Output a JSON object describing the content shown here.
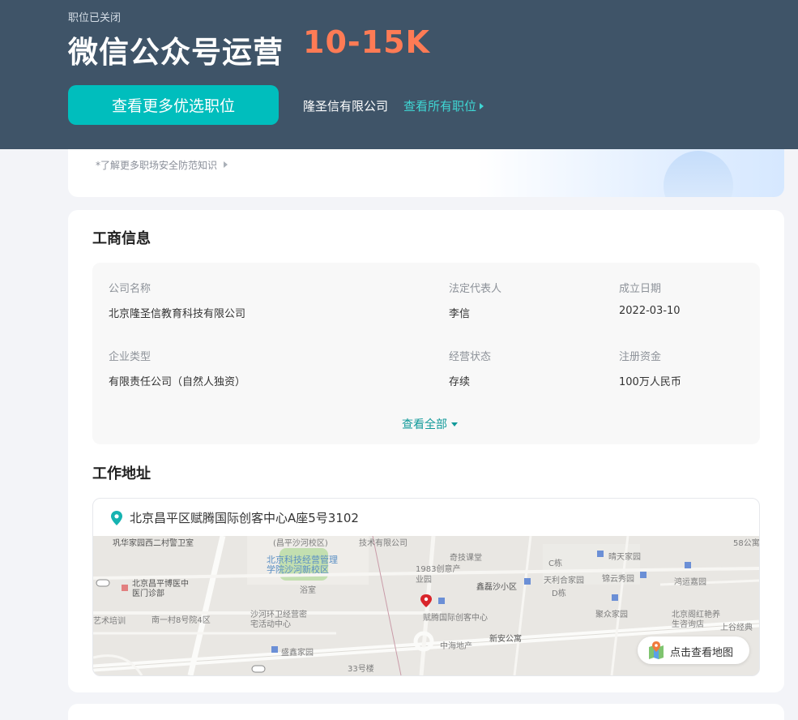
{
  "header": {
    "status": "职位已关闭",
    "job_title": "微信公众号运营",
    "salary": "10-15K",
    "more_jobs_button": "查看更多优选职位",
    "company": "隆圣信有限公司",
    "all_jobs_link": "查看所有职位"
  },
  "safety_tip": "*了解更多职场安全防范知识",
  "business_info": {
    "title": "工商信息",
    "fields": [
      {
        "label": "公司名称",
        "value": "北京隆圣信教育科技有限公司"
      },
      {
        "label": "法定代表人",
        "value": "李信"
      },
      {
        "label": "成立日期",
        "value": "2022-03-10"
      },
      {
        "label": "企业类型",
        "value": "有限责任公司（自然人独资）"
      },
      {
        "label": "经营状态",
        "value": "存续"
      },
      {
        "label": "注册资金",
        "value": "100万人民币"
      }
    ],
    "view_all": "查看全部"
  },
  "work_address": {
    "title": "工作地址",
    "address": "北京昌平区赋腾国际创客中心A座5号3102",
    "map_button": "点击查看地图",
    "map_labels": [
      "巩华家园西二村警卫室",
      "北京昌平博医中医门诊部",
      "艺术培训",
      "南一村8号院4区",
      "北京科技经营管理学院沙河新校区",
      "(昌平沙河校区)",
      "技术有限公司",
      "沙河环卫经营密宅活动中心",
      "浴室",
      "1983创意产业园",
      "奇技课堂",
      "鑫磊沙小区",
      "天利合家园",
      "C栋",
      "D栋",
      "锦云秀园",
      "晴天家园",
      "鸿运嘉园",
      "聚众家园",
      "赋腾国际创客中心",
      "新安公寓",
      "中海地产",
      "盛鑫家园",
      "33号楼",
      "北京阁红艳养生咨询店",
      "上谷经典",
      "58公寓"
    ]
  },
  "colors": {
    "header_bg": "#3f5468",
    "salary": "#fe7b55",
    "accent": "#00bebd",
    "link": "#3fd6d4"
  },
  "icons": [
    "location-pin-icon",
    "map-icon",
    "chevron-right-icon",
    "chevron-down-icon"
  ]
}
